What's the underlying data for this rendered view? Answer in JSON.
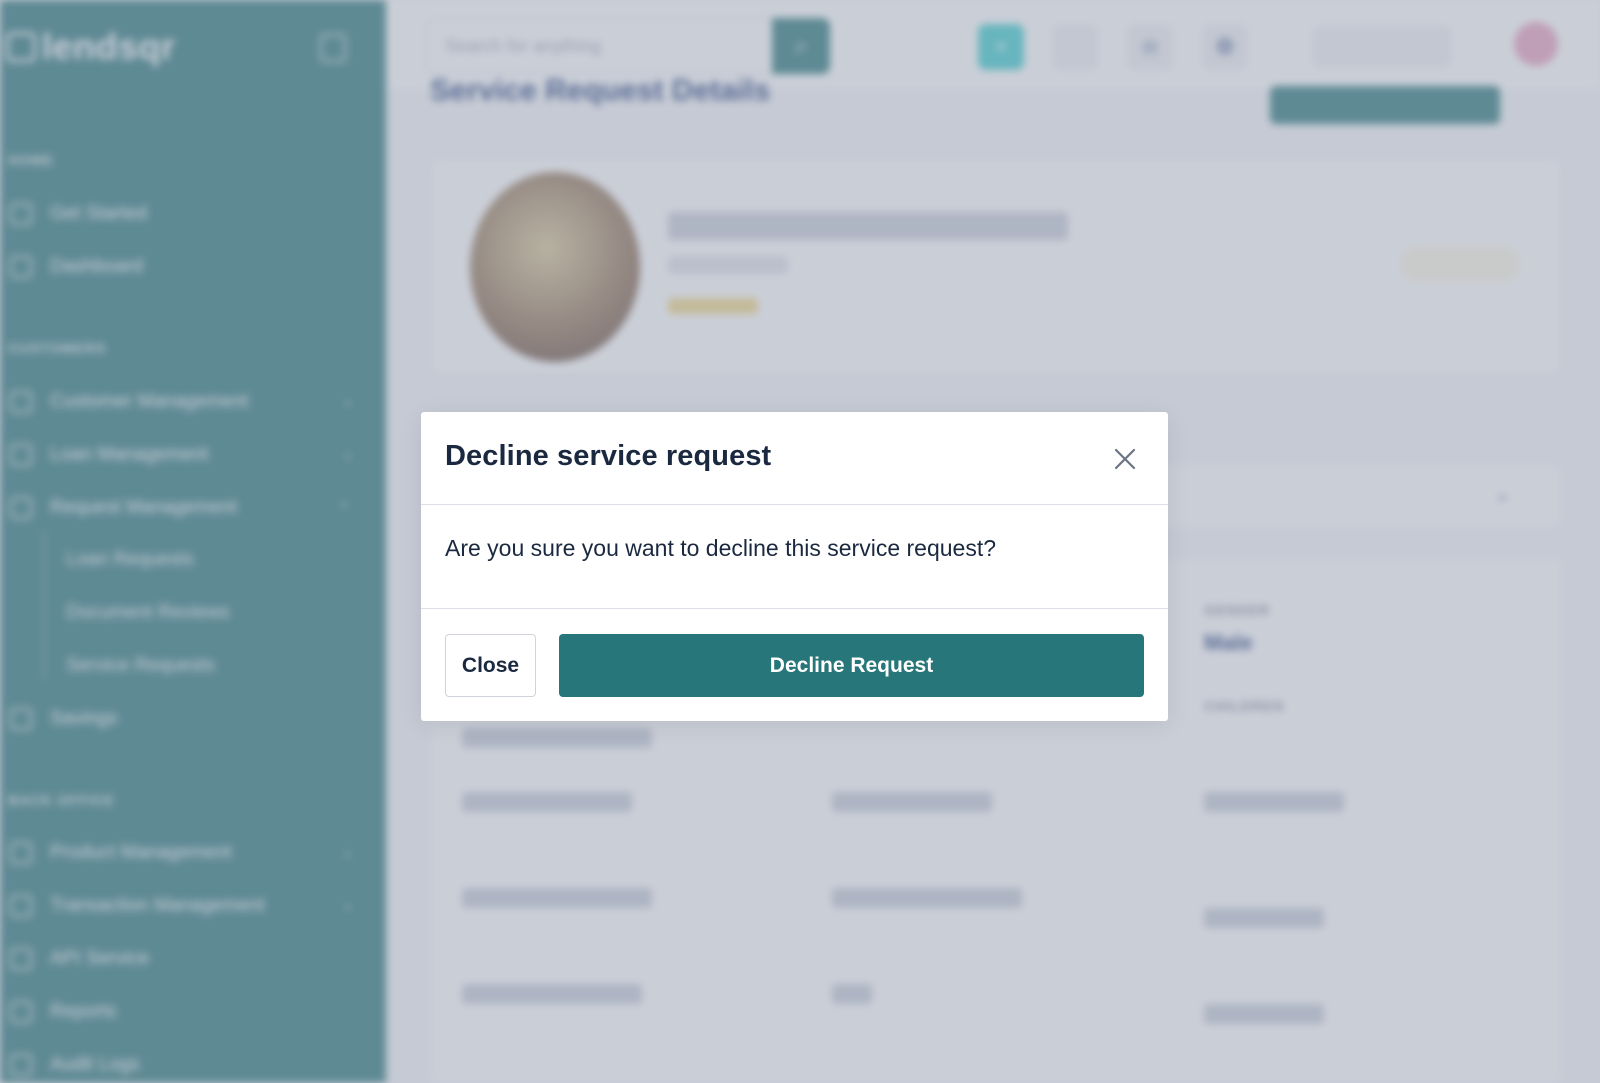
{
  "sidebar": {
    "logo_text": "lendsqr",
    "sections": {
      "home": "HOME",
      "customers": "CUSTOMERS",
      "back_office": "BACK OFFICE"
    },
    "items": {
      "get_started": "Get Started",
      "dashboard": "Dashboard",
      "customer_management": "Customer Management",
      "loan_management": "Loan Management",
      "request_management": "Request Management",
      "loan_requests": "Loan Requests",
      "document_reviews": "Document Reviews",
      "service_requests": "Service Requests",
      "savings": "Savings",
      "product_management": "Product Management",
      "transaction_management": "Transaction Management",
      "api_service": "API Service",
      "reports": "Reports",
      "audit_logs": "Audit Logs"
    }
  },
  "topbar": {
    "search_placeholder": "Search for anything"
  },
  "page": {
    "heading": "Service Request Details",
    "details": {
      "gender_label": "GENDER",
      "gender_value": "Male",
      "children_label": "CHILDREN"
    }
  },
  "modal": {
    "title": "Decline service request",
    "message": "Are you sure you want to decline this service request?",
    "close_label": "Close",
    "decline_label": "Decline Request"
  },
  "colors": {
    "brand": "#277679",
    "accent": "#39cdcc",
    "text_dark": "#1b2940",
    "overlay": "rgba(150,158,176,0.5)"
  }
}
